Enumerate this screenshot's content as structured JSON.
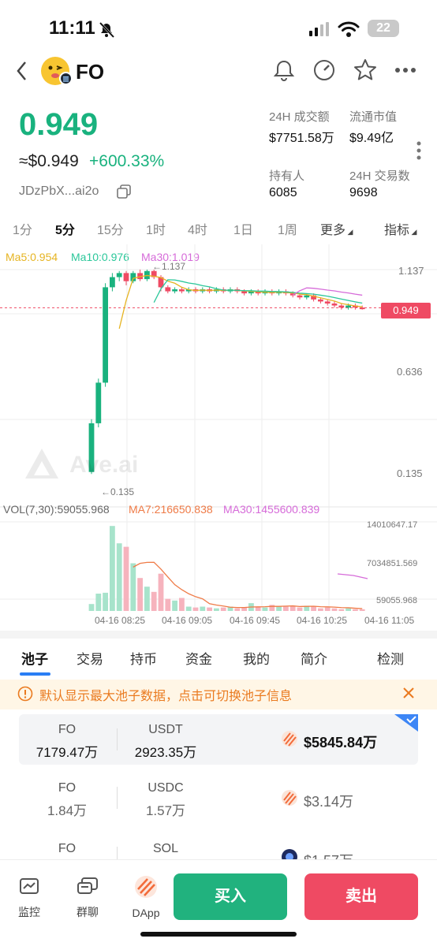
{
  "status_bar": {
    "time": "11:11",
    "battery": "22"
  },
  "header": {
    "token_name": "FO"
  },
  "price": {
    "value": "0.949",
    "usd": "≈$0.949",
    "change": "+600.33%",
    "address": "JDzPbX...ai2o"
  },
  "stats": [
    {
      "label": "24H 成交额",
      "value": "$7751.58万"
    },
    {
      "label": "流通市值",
      "value": "$9.49亿"
    },
    {
      "label": "持有人",
      "value": "6085"
    },
    {
      "label": "24H 交易数",
      "value": "9698"
    }
  ],
  "timeframes": [
    "1分",
    "5分",
    "15分",
    "1时",
    "4时",
    "1日",
    "1周",
    "更多",
    "指标"
  ],
  "active_timeframe": "5分",
  "ma": {
    "ma5": "Ma5:0.954",
    "ma10": "Ma10:0.976",
    "ma30": "Ma30:1.019"
  },
  "ma_colors": {
    "ma5": "#e6b422",
    "ma10": "#2bc79a",
    "ma30": "#d66bd9"
  },
  "chart_data": {
    "type": "candlestick",
    "price_axis": [
      "1.137",
      "0.636",
      "0.135"
    ],
    "current_price_tag": "0.949",
    "high_annotation": "←1.137",
    "low_annotation": "←0.135",
    "watermark": "Ave.ai",
    "x_labels": [
      "04-16 08:25",
      "04-16 09:05",
      "04-16 09:45",
      "04-16 10:25",
      "04-16 11:05"
    ],
    "candles": [
      {
        "o": 0.14,
        "c": 0.38,
        "h": 0.4,
        "l": 0.13
      },
      {
        "o": 0.38,
        "c": 0.58,
        "h": 0.6,
        "l": 0.36
      },
      {
        "o": 0.58,
        "c": 1.05,
        "h": 1.07,
        "l": 0.56
      },
      {
        "o": 1.05,
        "c": 1.1,
        "h": 1.12,
        "l": 1.03
      },
      {
        "o": 1.1,
        "c": 1.12,
        "h": 1.13,
        "l": 1.08
      },
      {
        "o": 1.12,
        "c": 1.08,
        "h": 1.13,
        "l": 1.06
      },
      {
        "o": 1.08,
        "c": 1.12,
        "h": 1.13,
        "l": 1.07
      },
      {
        "o": 1.12,
        "c": 1.09,
        "h": 1.137,
        "l": 1.08
      },
      {
        "o": 1.09,
        "c": 1.13,
        "h": 1.137,
        "l": 1.08
      },
      {
        "o": 1.13,
        "c": 1.1,
        "h": 1.137,
        "l": 1.09
      },
      {
        "o": 1.1,
        "c": 1.05,
        "h": 1.11,
        "l": 1.03
      },
      {
        "o": 1.05,
        "c": 1.03,
        "h": 1.06,
        "l": 1.02
      },
      {
        "o": 1.03,
        "c": 1.04,
        "h": 1.05,
        "l": 1.02
      },
      {
        "o": 1.04,
        "c": 1.03,
        "h": 1.05,
        "l": 1.02
      },
      {
        "o": 1.03,
        "c": 1.04,
        "h": 1.05,
        "l": 1.02
      },
      {
        "o": 1.04,
        "c": 1.03,
        "h": 1.05,
        "l": 1.02
      },
      {
        "o": 1.03,
        "c": 1.04,
        "h": 1.05,
        "l": 1.02
      },
      {
        "o": 1.04,
        "c": 1.03,
        "h": 1.05,
        "l": 1.02
      },
      {
        "o": 1.03,
        "c": 1.04,
        "h": 1.05,
        "l": 1.02
      },
      {
        "o": 1.04,
        "c": 1.03,
        "h": 1.05,
        "l": 1.02
      },
      {
        "o": 1.03,
        "c": 1.04,
        "h": 1.05,
        "l": 1.02
      },
      {
        "o": 1.04,
        "c": 1.03,
        "h": 1.05,
        "l": 1.02
      },
      {
        "o": 1.03,
        "c": 1.02,
        "h": 1.04,
        "l": 1.01
      },
      {
        "o": 1.02,
        "c": 1.03,
        "h": 1.04,
        "l": 1.01
      },
      {
        "o": 1.03,
        "c": 1.02,
        "h": 1.04,
        "l": 1.01
      },
      {
        "o": 1.02,
        "c": 1.03,
        "h": 1.04,
        "l": 1.01
      },
      {
        "o": 1.03,
        "c": 1.02,
        "h": 1.04,
        "l": 1.01
      },
      {
        "o": 1.02,
        "c": 1.03,
        "h": 1.04,
        "l": 1.01
      },
      {
        "o": 1.03,
        "c": 1.02,
        "h": 1.04,
        "l": 1.01
      },
      {
        "o": 1.02,
        "c": 1.01,
        "h": 1.03,
        "l": 1.0
      },
      {
        "o": 1.01,
        "c": 1.0,
        "h": 1.02,
        "l": 0.99
      },
      {
        "o": 1.0,
        "c": 1.01,
        "h": 1.02,
        "l": 0.99
      },
      {
        "o": 1.01,
        "c": 0.99,
        "h": 1.02,
        "l": 0.98
      },
      {
        "o": 0.99,
        "c": 0.98,
        "h": 1.0,
        "l": 0.97
      },
      {
        "o": 0.98,
        "c": 0.97,
        "h": 0.99,
        "l": 0.96
      },
      {
        "o": 0.97,
        "c": 0.96,
        "h": 0.98,
        "l": 0.95
      },
      {
        "o": 0.96,
        "c": 0.95,
        "h": 0.97,
        "l": 0.94
      },
      {
        "o": 0.95,
        "c": 0.96,
        "h": 0.97,
        "l": 0.94
      },
      {
        "o": 0.96,
        "c": 0.95,
        "h": 0.97,
        "l": 0.94
      },
      {
        "o": 0.95,
        "c": 0.949,
        "h": 0.96,
        "l": 0.94
      }
    ],
    "volume_label": "VOL(7,30):59055.968",
    "vol_ma7": "MA7:216650.838",
    "vol_ma30": "MA30:1455600.839",
    "volume_axis": [
      "14010647.17",
      "7034851.569",
      "59055.968"
    ],
    "volumes": [
      0.08,
      0.2,
      0.21,
      0.98,
      0.78,
      0.74,
      0.55,
      0.38,
      0.28,
      0.22,
      0.43,
      0.14,
      0.12,
      0.15,
      0.05,
      0.04,
      0.05,
      0.04,
      0.03,
      0.04,
      0.05,
      0.03,
      0.04,
      0.09,
      0.05,
      0.04,
      0.07,
      0.05,
      0.05,
      0.06,
      0.04,
      0.06,
      0.05,
      0.03,
      0.04,
      0.03,
      0.02,
      0.03,
      0.02,
      0.02
    ]
  },
  "tabs": [
    "池子",
    "交易",
    "持币",
    "资金",
    "我的",
    "简介",
    "检测"
  ],
  "notice": "默认显示最大池子数据，点击可切换池子信息",
  "pools": [
    {
      "token_a": "FO",
      "amount_a": "7179.47万",
      "token_b": "USDT",
      "amount_b": "2923.35万",
      "total": "$5845.84万"
    },
    {
      "token_a": "FO",
      "amount_a": "1.84万",
      "token_b": "USDC",
      "amount_b": "1.57万",
      "total": "$3.14万"
    },
    {
      "token_a": "FO",
      "amount_a": "",
      "token_b": "SOL",
      "amount_b": "",
      "total": "$1.57万"
    }
  ],
  "bottom_nav": {
    "monitor": "监控",
    "group_chat": "群聊",
    "dapp": "DApp",
    "buy": "买入",
    "sell": "卖出"
  },
  "colors": {
    "up": "#19b27e",
    "down": "#ef4a63",
    "accent": "#2a7ef5",
    "warning": "#ea7a1f"
  }
}
